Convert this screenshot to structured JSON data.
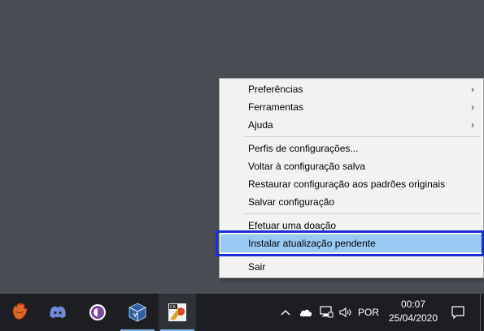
{
  "menu": {
    "items": [
      {
        "label": "Preferências",
        "submenu": true
      },
      {
        "label": "Ferramentas",
        "submenu": true
      },
      {
        "label": "Ajuda",
        "submenu": true
      },
      {
        "label": "Perfis de configurações..."
      },
      {
        "label": "Voltar à configuração salva"
      },
      {
        "label": "Restaurar configuração aos padrões originais"
      },
      {
        "label": "Salvar configuração"
      },
      {
        "label": "Efetuar uma doação"
      },
      {
        "label": "Instalar atualização pendente",
        "highlighted": true
      },
      {
        "label": "Sair"
      }
    ],
    "submenu_arrow": "›"
  },
  "taskbar": {
    "apps": [
      {
        "name": "baseball-glove-app-icon"
      },
      {
        "name": "discord-icon"
      },
      {
        "name": "tor-browser-icon"
      },
      {
        "name": "virtualbox-icon",
        "running": true
      },
      {
        "name": "ca-app-icon",
        "running": true,
        "active": true
      }
    ],
    "tray": {
      "language": "POR",
      "time": "00:07",
      "date": "25/04/2020"
    }
  },
  "colors": {
    "desktop": "#4a4e54",
    "menu_bg": "#f2f2f2",
    "highlight": "#99c9f5",
    "focus_border": "#1a2fd6",
    "taskbar": "#1c1e21"
  }
}
